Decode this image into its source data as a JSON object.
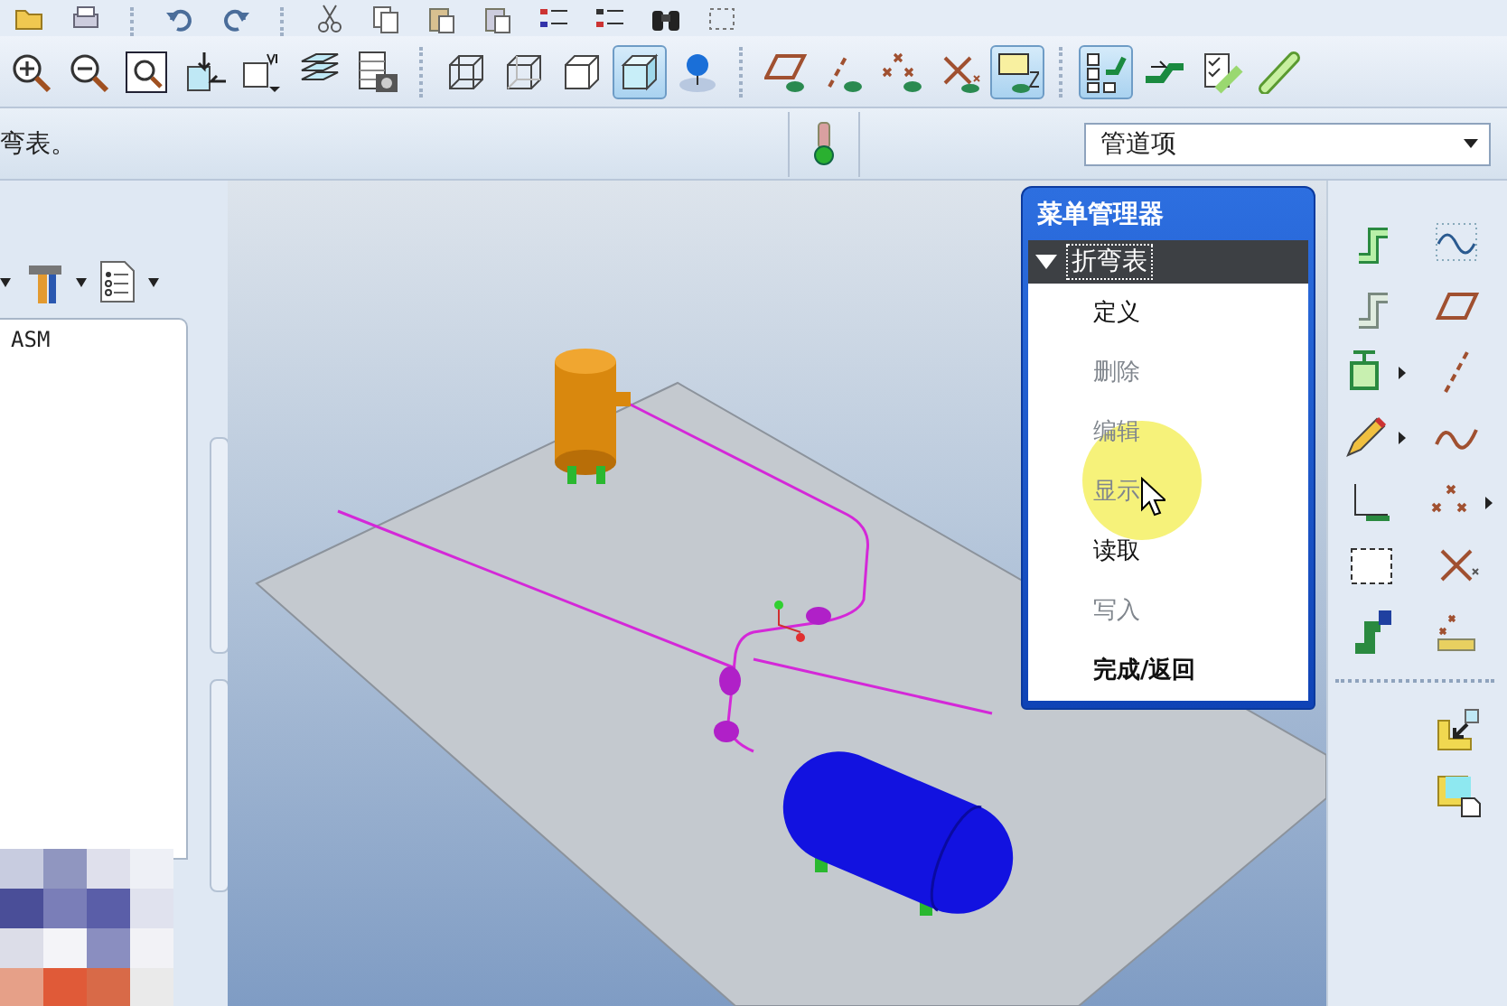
{
  "toolbar_row_1": [
    {
      "pressed": false
    },
    {
      "pressed": false
    },
    {
      "pressed": false
    },
    {
      "pressed": false
    },
    {
      "pressed": false
    },
    {
      "pressed": false
    },
    {
      "pressed": false
    },
    {
      "pressed": false
    },
    {
      "pressed": false
    },
    {
      "pressed": false
    },
    {
      "pressed": false
    },
    {
      "pressed": false
    }
  ],
  "toolbar_row_2": [
    {
      "pressed": false
    },
    {
      "pressed": false
    },
    {
      "pressed": false
    },
    {
      "pressed": false
    },
    {
      "pressed": false
    },
    {
      "pressed": false
    },
    {
      "pressed": false
    },
    {
      "pressed": false
    },
    {
      "pressed": false
    },
    {
      "pressed": false
    },
    {
      "pressed": true
    },
    {
      "pressed": false
    },
    {
      "pressed": false
    },
    {
      "pressed": false
    },
    {
      "pressed": false
    },
    {
      "pressed": false
    },
    {
      "pressed": true
    },
    {
      "pressed": true
    },
    {
      "pressed": false
    },
    {
      "pressed": false
    },
    {
      "pressed": false
    }
  ],
  "message_bar": {
    "message": "弯表。",
    "selector": {
      "value": "管道项"
    }
  },
  "model_tree": {
    "items": [
      {
        "label": "ASM"
      }
    ]
  },
  "menu_manager": {
    "title": "菜单管理器",
    "section": {
      "label": "折弯表",
      "expanded": true,
      "items": [
        {
          "label": "定义",
          "disabled": false,
          "kind": "command"
        },
        {
          "label": "删除",
          "disabled": true,
          "kind": "command"
        },
        {
          "label": "编辑",
          "disabled": true,
          "kind": "command"
        },
        {
          "label": "显示",
          "disabled": true,
          "kind": "command"
        },
        {
          "label": "读取",
          "disabled": false,
          "kind": "command"
        },
        {
          "label": "写入",
          "disabled": true,
          "kind": "command"
        },
        {
          "label": "完成/返回",
          "disabled": false,
          "kind": "done"
        }
      ]
    }
  }
}
